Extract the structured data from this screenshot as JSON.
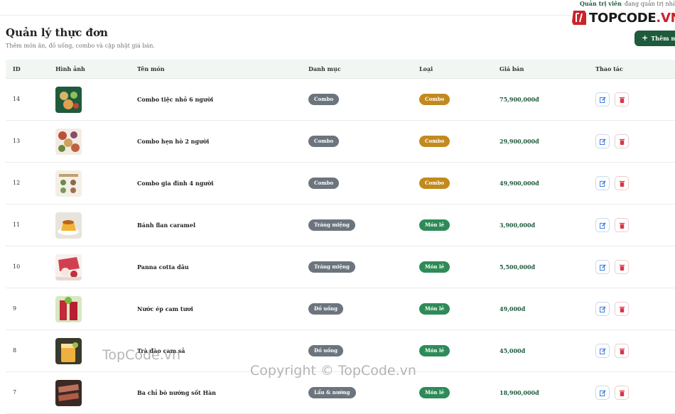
{
  "topbar": {
    "admin_label": "Quản trị viên",
    "admin_desc": "đang quản trị nhà h"
  },
  "logo": {
    "prefix": "TOPCODE",
    "suffix": ".VN"
  },
  "header": {
    "title": "Quản lý thực đơn",
    "subtitle": "Thêm món ăn, đồ uống, combo và cập nhật giá bán.",
    "add_button": "Thêm mó"
  },
  "table": {
    "columns": [
      "ID",
      "Hình ảnh",
      "Tên món",
      "Danh mục",
      "Loại",
      "Giá bán",
      "Thao tác"
    ],
    "rows": [
      {
        "id": "14",
        "name": "Combo tiệc nhỏ 6 người",
        "category": "Combo",
        "type": "Combo",
        "price": "75,900,000đ",
        "image": "combo-party-food-image"
      },
      {
        "id": "13",
        "name": "Combo hẹn hò 2 người",
        "category": "Combo",
        "type": "Combo",
        "price": "29,900,000đ",
        "image": "combo-date-food-image"
      },
      {
        "id": "12",
        "name": "Combo gia đình 4 người",
        "category": "Combo",
        "type": "Combo",
        "price": "49,900,000đ",
        "image": "combo-family-food-image"
      },
      {
        "id": "11",
        "name": "Bánh flan caramel",
        "category": "Tráng miệng",
        "type": "Món lẻ",
        "price": "3,900,000đ",
        "image": "flan-caramel-image"
      },
      {
        "id": "10",
        "name": "Panna cotta dâu",
        "category": "Tráng miệng",
        "type": "Món lẻ",
        "price": "5,500,000đ",
        "image": "panna-cotta-image"
      },
      {
        "id": "9",
        "name": "Nước ép cam tươi",
        "category": "Đồ uống",
        "type": "Món lẻ",
        "price": "49,000đ",
        "image": "orange-juice-image"
      },
      {
        "id": "8",
        "name": "Trà đào cam sả",
        "category": "Đồ uống",
        "type": "Món lẻ",
        "price": "45,000đ",
        "image": "peach-tea-image"
      },
      {
        "id": "7",
        "name": "Ba chỉ bò nướng sốt Hàn",
        "category": "Lẩu & nướng",
        "type": "Món lẻ",
        "price": "18,900,000đ",
        "image": "grilled-beef-image"
      }
    ]
  },
  "colors": {
    "brand_green": "#1e5a3c",
    "combo_badge": "#c28a1e",
    "single_badge": "#2e8b57",
    "category_badge": "#6c757d",
    "edit_blue": "#2a6fdb",
    "delete_red": "#dc3545"
  },
  "watermarks": {
    "small": "TopCode.vn",
    "copyright": "Copyright © TopCode.vn"
  }
}
